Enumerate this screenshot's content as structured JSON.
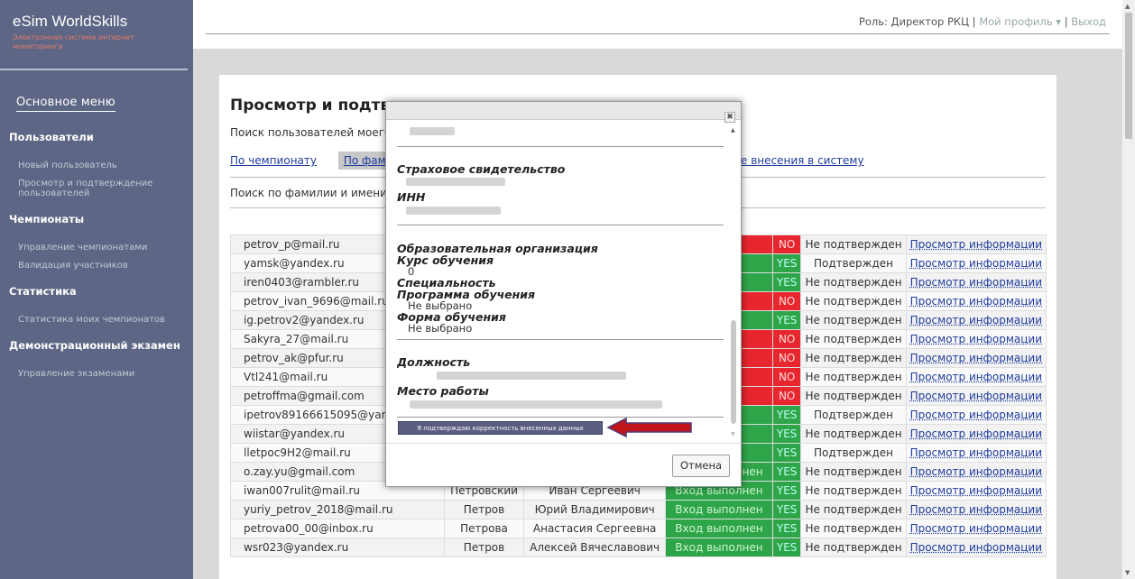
{
  "app": {
    "title": "eSim WorldSkills",
    "subtitle": "Электронная система интернет мониторинга"
  },
  "header": {
    "role": "Роль: Директор РКЦ",
    "sep1": " | ",
    "profile": "Мой профиль",
    "dropdown_icon": "▾",
    "sep2": " | ",
    "logout": "Выход"
  },
  "sidebar": {
    "menu_heading": "Основное меню",
    "sections": [
      {
        "title": "Пользователи",
        "items": [
          "Новый пользователь",
          "Просмотр и подтверждение пользователей"
        ]
      },
      {
        "title": "Чемпионаты",
        "items": [
          "Управление чемпионатами",
          "Валидация участников"
        ]
      },
      {
        "title": "Статистика",
        "items": [
          "Статистика моих чемпионатов"
        ]
      },
      {
        "title": "Демонстрационный экзамен",
        "items": [
          "Управление экзаменами"
        ]
      }
    ]
  },
  "main": {
    "title": "Просмотр и подтвер",
    "subtitle": "Поиск пользователей моего",
    "tab_championship": "По чемпионату",
    "tab_surname": "По фами",
    "tab_date": "е внесения в систему",
    "search_label": "Поиск по фамилии и имени"
  },
  "table": {
    "rows": [
      {
        "email": "petrov_p@mail.ru",
        "surname": "",
        "name": "",
        "login": "полнен",
        "login_ok": false,
        "flag": "NO",
        "status": "Не подтвержден",
        "view": "Просмотр информации"
      },
      {
        "email": "yamsk@yandex.ru",
        "surname": "",
        "name": "",
        "login": "лнен",
        "login_ok": true,
        "flag": "YES",
        "status": "Подтвержден",
        "view": "Просмотр информации"
      },
      {
        "email": "iren0403@rambler.ru",
        "surname": "",
        "name": "",
        "login": "лнен",
        "login_ok": true,
        "flag": "YES",
        "status": "Не подтвержден",
        "view": "Просмотр информации"
      },
      {
        "email": "petrov_ivan_9696@mail.ru",
        "surname": "",
        "name": "",
        "login": "олнен",
        "login_ok": false,
        "flag": "NO",
        "status": "Не подтвержден",
        "view": "Просмотр информации"
      },
      {
        "email": "ig.petrov2@yandex.ru",
        "surname": "",
        "name": "",
        "login": "лнен",
        "login_ok": true,
        "flag": "YES",
        "status": "Не подтвержден",
        "view": "Просмотр информации"
      },
      {
        "email": "Sakyra_27@mail.ru",
        "surname": "",
        "name": "",
        "login": "олнен",
        "login_ok": false,
        "flag": "NO",
        "status": "Не подтвержден",
        "view": "Просмотр информации"
      },
      {
        "email": "petrov_ak@pfur.ru",
        "surname": "",
        "name": "",
        "login": "олнен",
        "login_ok": false,
        "flag": "NO",
        "status": "Не подтвержден",
        "view": "Просмотр информации"
      },
      {
        "email": "Vtl241@mail.ru",
        "surname": "",
        "name": "",
        "login": "олнен",
        "login_ok": false,
        "flag": "NO",
        "status": "Не подтвержден",
        "view": "Просмотр информации"
      },
      {
        "email": "petroffma@gmail.com",
        "surname": "",
        "name": "",
        "login": "олнен",
        "login_ok": false,
        "flag": "NO",
        "status": "Не подтвержден",
        "view": "Просмотр информации"
      },
      {
        "email": "ipetrov89166615095@yand",
        "surname": "",
        "name": "",
        "login": "лнен",
        "login_ok": true,
        "flag": "YES",
        "status": "Подтвержден",
        "view": "Просмотр информации"
      },
      {
        "email": "wiistar@yandex.ru",
        "surname": "",
        "name": "",
        "login": "лнен",
        "login_ok": true,
        "flag": "YES",
        "status": "Не подтвержден",
        "view": "Просмотр информации"
      },
      {
        "email": "lletpoc9H2@mail.ru",
        "surname": "",
        "name": "",
        "login": "лнен",
        "login_ok": true,
        "flag": "YES",
        "status": "Подтвержден",
        "view": "Просмотр информации"
      },
      {
        "email": "o.zay.yu@gmail.com",
        "surname": "Петров",
        "name": "Сергей",
        "login": "Вход выполнен",
        "login_ok": true,
        "flag": "YES",
        "status": "Не подтвержден",
        "view": "Просмотр информации"
      },
      {
        "email": "iwan007rulit@mail.ru",
        "surname": "Петровский",
        "name": "Иван Сергеевич",
        "login": "Вход выполнен",
        "login_ok": true,
        "flag": "YES",
        "status": "Не подтвержден",
        "view": "Просмотр информации"
      },
      {
        "email": "yuriy_petrov_2018@mail.ru",
        "surname": "Петров",
        "name": "Юрий Владимирович",
        "login": "Вход выполнен",
        "login_ok": true,
        "flag": "YES",
        "status": "Не подтвержден",
        "view": "Просмотр информации"
      },
      {
        "email": "petrova00_00@inbox.ru",
        "surname": "Петрова",
        "name": "Анастасия Сергеевна",
        "login": "Вход выполнен",
        "login_ok": true,
        "flag": "YES",
        "status": "Не подтвержден",
        "view": "Просмотр информации"
      },
      {
        "email": "wsr023@yandex.ru",
        "surname": "Петров",
        "name": "Алексей Вячеславович",
        "login": "Вход выполнен",
        "login_ok": true,
        "flag": "YES",
        "status": "Не подтвержден",
        "view": "Просмотр информации"
      }
    ]
  },
  "modal": {
    "close_icon": "✖",
    "insurance_label": "Страховое свидетельство",
    "inn_label": "ИНН",
    "edu_org_label": "Образовательная организация",
    "course_label": "Курс обучения",
    "course_value": "0",
    "specialty_label": "Специальность",
    "program_label": "Программа обучения",
    "program_value": "Не выбрано",
    "form_label": "Форма обучения",
    "form_value": "Не выбрано",
    "position_label": "Должность",
    "workplace_label": "Место работы",
    "confirm_button": "Я подтверждаю корректность внесенных данных",
    "cancel_button": "Отмена"
  },
  "colors": {
    "sidebar": "#5d6684",
    "login_ok": "#2fa54a",
    "login_fail": "#e8262e",
    "confirm_button": "#5a5c80",
    "arrow": "#c0141b"
  }
}
